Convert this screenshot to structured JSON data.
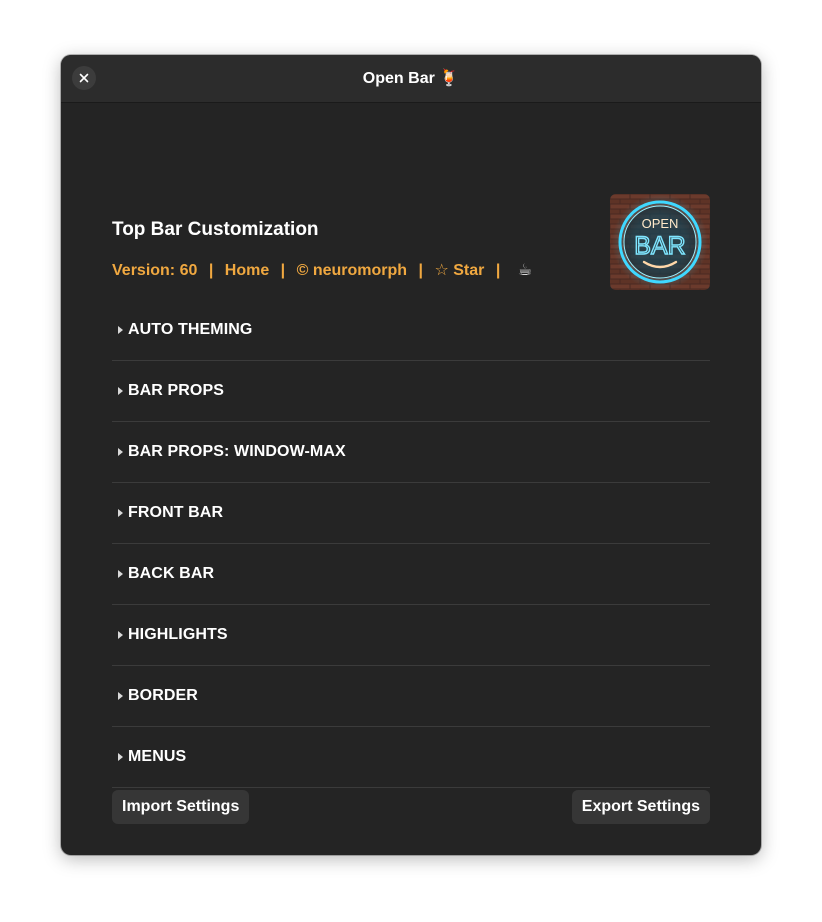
{
  "window": {
    "title": "Open Bar 🍹"
  },
  "header": {
    "title": "Top Bar Customization",
    "version": "Version: 60",
    "home": "Home",
    "author": "© neuromorph",
    "star": "☆ Star",
    "coffee": "☕",
    "separator": "|"
  },
  "logo": {
    "line1": "OPEN",
    "line2": "BAR"
  },
  "sections": [
    {
      "label": "AUTO THEMING"
    },
    {
      "label": "BAR PROPS"
    },
    {
      "label": "BAR PROPS: WINDOW-MAX"
    },
    {
      "label": "FRONT BAR"
    },
    {
      "label": "BACK BAR"
    },
    {
      "label": "HIGHLIGHTS"
    },
    {
      "label": "BORDER"
    },
    {
      "label": "MENUS"
    }
  ],
  "footer": {
    "import_label": "Import Settings",
    "export_label": "Export Settings"
  },
  "colors": {
    "accent": "#f0a840",
    "background": "#242424",
    "titlebar": "#2c2c2c",
    "neon": "#3fd8ff"
  }
}
